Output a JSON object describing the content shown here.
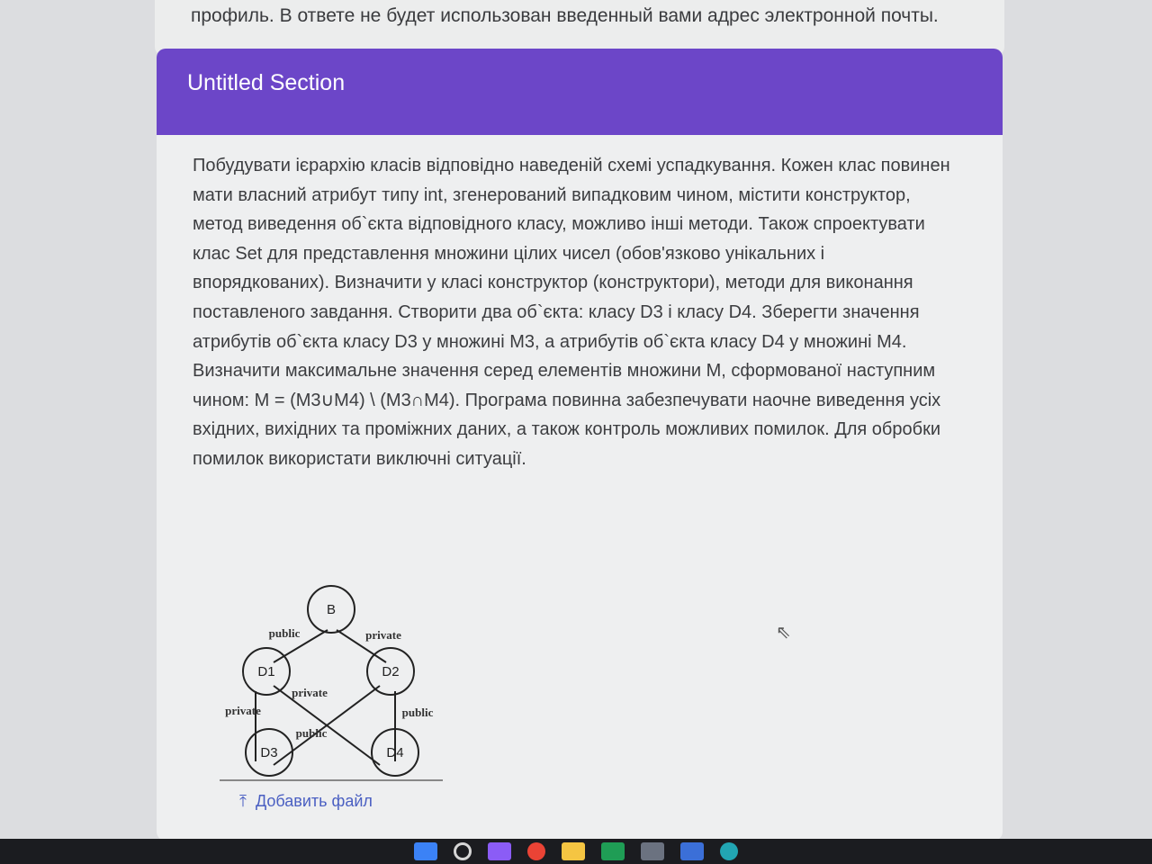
{
  "top_notice": "профиль. В ответе не будет использован введенный вами адрес электронной почты.",
  "section": {
    "title": "Untitled Section",
    "description": "Побудувати ієрархію класів відповідно наведеній схемі успадкування. Кожен клас повинен мати власний атрибут типу int, згенерований випадковим чином, містити конструктор, метод виведення об`єкта відповідного класу, можливо інші методи. Також спроектувати клас Set для представлення множини цілих чисел (обов'язково унікальних і впорядкованих). Визначити у класі конструктор (конструктори), методи для виконання поставленого завдання. Створити два об`єкта: класу D3 і класу D4. Зберегти значення атрибутів об`єкта класу D3 у множині M3, а атрибутів об`єкта класу D4 у множині M4. Визначити максимальне значення серед елементів множини M, сформованої наступним чином: M = (M3∪M4) \\ (M3∩M4). Програма повинна забезпечувати наочне виведення усіх вхідних, вихідних та проміжних даних, а також контроль можливих помилок. Для обробки помилок використати виключні ситуації."
  },
  "diagram": {
    "nodes": {
      "b": "B",
      "d1": "D1",
      "d2": "D2",
      "d3": "D3",
      "d4": "D4"
    },
    "edges": {
      "b_d1": "public",
      "b_d2": "private",
      "d1_d3": "private",
      "d1_d4": "private",
      "d2_d3": "public",
      "d2_d4": "public"
    }
  },
  "upload_label": "Добавить файл",
  "taskbar_icons": [
    "windows-start",
    "search",
    "visual-studio",
    "chrome",
    "file-explorer",
    "pycharm",
    "calculator",
    "app",
    "edge"
  ]
}
